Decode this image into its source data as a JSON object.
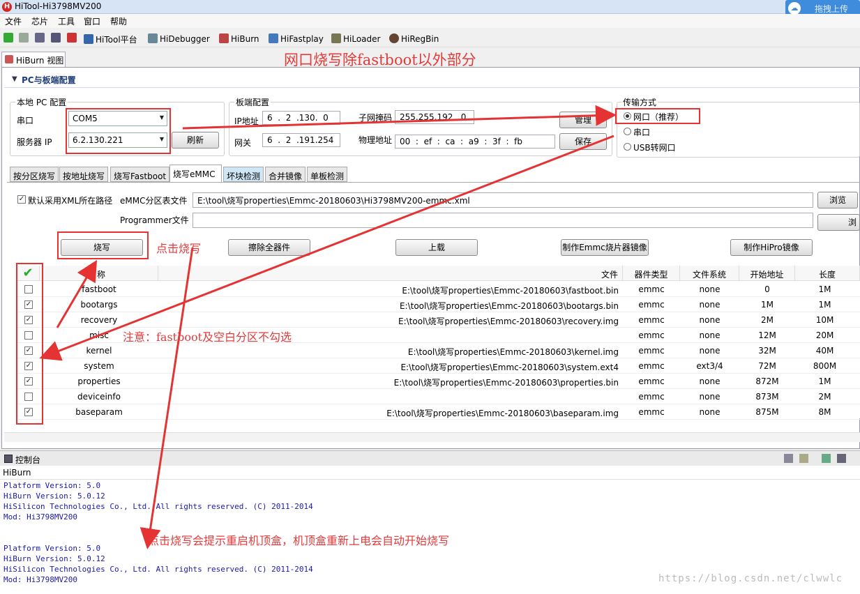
{
  "window": {
    "title": "HiTool-Hi3798MV200",
    "app_icon_letter": "H",
    "upload_button": "拖拽上传"
  },
  "menu": [
    "文件",
    "芯片",
    "工具",
    "窗口",
    "帮助"
  ],
  "toolbar": {
    "items": [
      "HiTool平台",
      "HiDebugger",
      "HiBurn",
      "HiFastplay",
      "HiLoader",
      "HiRegBin"
    ]
  },
  "view_tab": "HiBurn 视图",
  "section": {
    "title": "PC与板端配置"
  },
  "local_pc": {
    "group": "本地 PC 配置",
    "serial_label": "串口",
    "serial_value": "COM5",
    "server_ip_label": "服务器 IP",
    "server_ip_value": "6.2.130.221",
    "refresh": "刷新"
  },
  "board": {
    "group": "板端配置",
    "ip_label": "IP地址",
    "ip_value": "6  .  2  .130.  0",
    "gateway_label": "网关",
    "gateway_value": "6  .  2  .191.254",
    "mask_label": "子网掩码",
    "mask_value": "255.255.192.  0",
    "mac_label": "物理地址",
    "mac_value": "00  :  ef  :  ca  :  a9  :  3f  :  fb",
    "manage": "管理",
    "save": "保存"
  },
  "transfer": {
    "group": "传输方式",
    "options": [
      "网口（推荐）",
      "串口",
      "USB转网口"
    ],
    "selected": "网口（推荐）"
  },
  "tabs": [
    "按分区烧写",
    "按地址烧写",
    "烧写Fastboot",
    "烧写eMMC",
    "坏块检测",
    "合并镜像",
    "单板检测"
  ],
  "active_tab": "烧写eMMC",
  "emmc": {
    "use_xml_path_label": "默认采用XML所在路径",
    "use_xml_path_checked": true,
    "partition_file_label": "eMMC分区表文件",
    "partition_file_value": "E:\\tool\\烧写properties\\Emmc-20180603\\Hi3798MV200-emmc.xml",
    "programmer_label": "Programmer文件",
    "programmer_value": "",
    "browse": "浏览",
    "browse2": "浏",
    "buttons": {
      "burn": "烧写",
      "erase": "擦除全器件",
      "upload": "上载",
      "make_emmc": "制作Emmc烧片器镜像",
      "make_hipro": "制作HiPro镜像"
    }
  },
  "table": {
    "headers": [
      "名称",
      "文件",
      "器件类型",
      "文件系统",
      "开始地址",
      "长度"
    ],
    "rows": [
      {
        "checked": false,
        "name": "fastboot",
        "file": "E:\\tool\\烧写properties\\Emmc-20180603\\fastboot.bin",
        "type": "emmc",
        "fs": "none",
        "start": "0",
        "len": "1M"
      },
      {
        "checked": true,
        "name": "bootargs",
        "file": "E:\\tool\\烧写properties\\Emmc-20180603\\bootargs.bin",
        "type": "emmc",
        "fs": "none",
        "start": "1M",
        "len": "1M"
      },
      {
        "checked": true,
        "name": "recovery",
        "file": "E:\\tool\\烧写properties\\Emmc-20180603\\recovery.img",
        "type": "emmc",
        "fs": "none",
        "start": "2M",
        "len": "10M"
      },
      {
        "checked": false,
        "name": "misc",
        "file": "",
        "type": "emmc",
        "fs": "none",
        "start": "12M",
        "len": "20M"
      },
      {
        "checked": true,
        "name": "kernel",
        "file": "E:\\tool\\烧写properties\\Emmc-20180603\\kernel.img",
        "type": "emmc",
        "fs": "none",
        "start": "32M",
        "len": "40M"
      },
      {
        "checked": true,
        "name": "system",
        "file": "E:\\tool\\烧写properties\\Emmc-20180603\\system.ext4",
        "type": "emmc",
        "fs": "ext3/4",
        "start": "72M",
        "len": "800M"
      },
      {
        "checked": true,
        "name": "properties",
        "file": "E:\\tool\\烧写properties\\Emmc-20180603\\properties.bin",
        "type": "emmc",
        "fs": "none",
        "start": "872M",
        "len": "1M"
      },
      {
        "checked": false,
        "name": "deviceinfo",
        "file": "",
        "type": "emmc",
        "fs": "none",
        "start": "873M",
        "len": "2M"
      },
      {
        "checked": true,
        "name": "baseparam",
        "file": "E:\\tool\\烧写properties\\Emmc-20180603\\baseparam.img",
        "type": "emmc",
        "fs": "none",
        "start": "875M",
        "len": "8M"
      }
    ]
  },
  "console": {
    "title": "控制台",
    "name": "HiBurn",
    "lines": [
      "Platform Version: 5.0",
      "HiBurn Version: 5.0.12",
      "HiSilicon Technologies Co., Ltd. All rights reserved. (C) 2011-2014",
      "Mod: Hi3798MV200",
      "",
      "",
      "Platform Version: 5.0",
      "HiBurn Version: 5.0.12",
      "HiSilicon Technologies Co., Ltd. All rights reserved. (C) 2011-2014",
      "Mod: Hi3798MV200"
    ]
  },
  "annotations": {
    "top": "网口烧写除fastboot以外部分",
    "click_burn": "点击烧写",
    "note": "注意：fastboot及空白分区不勾选",
    "bottom": "点击烧写会提示重启机顶盒，机顶盒重新上电会自动开始烧写",
    "color": "#e53333"
  },
  "watermark": "https://blog.csdn.net/clwwlc"
}
